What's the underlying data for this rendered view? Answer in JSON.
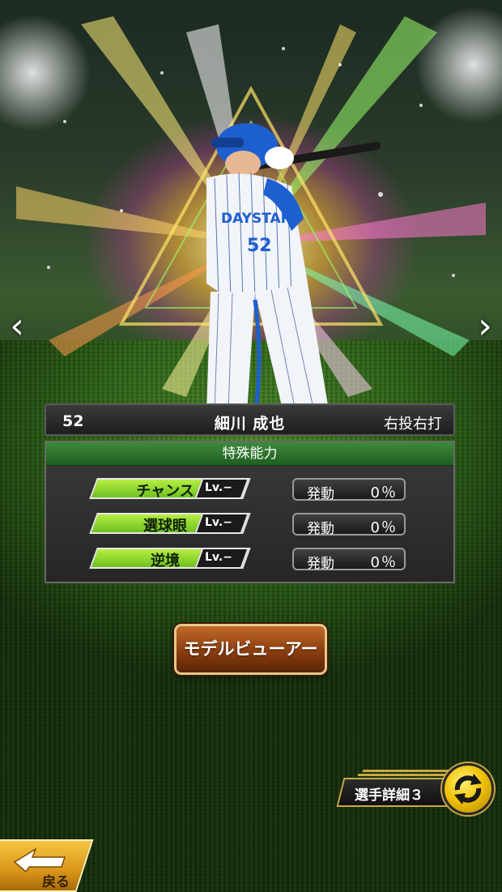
{
  "player": {
    "number": "52",
    "name": "細川 成也",
    "throw_bat": "右投右打",
    "uniform_text": "DAYSTARS",
    "uniform_number": "52"
  },
  "abilities": {
    "header": "特殊能力",
    "items": [
      {
        "name": "チャンス",
        "level": "Lv.−",
        "activate_label": "発動",
        "activate_value": "0％"
      },
      {
        "name": "選球眼",
        "level": "Lv.−",
        "activate_label": "発動",
        "activate_value": "0％"
      },
      {
        "name": "逆境",
        "level": "Lv.−",
        "activate_label": "発動",
        "activate_value": "0％"
      }
    ]
  },
  "buttons": {
    "model_viewer": "モデルビューアー",
    "player_detail": "選手詳細３",
    "back": "戻る"
  },
  "nav": {
    "prev_glyph": "‹",
    "next_glyph": "›"
  },
  "colors": {
    "ability_green": "#8edc2c",
    "header_green": "#2f7a2e",
    "gold": "#c9a846",
    "button_brown": "#8a3d10",
    "uniform_blue": "#1e5fd0"
  }
}
